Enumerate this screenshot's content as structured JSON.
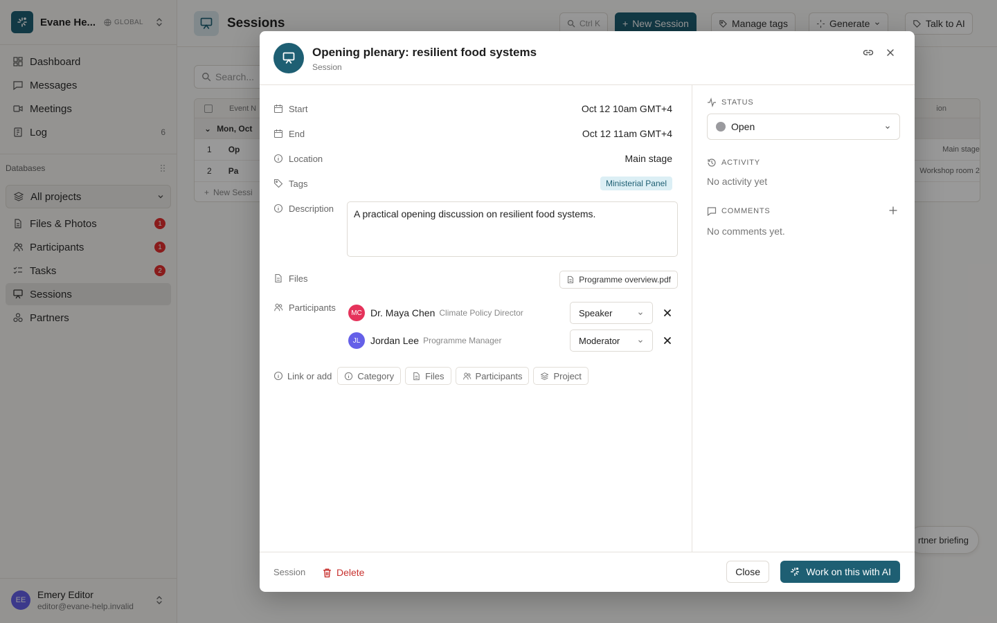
{
  "workspace": {
    "name": "Evane He...",
    "scope": "GLOBAL"
  },
  "sidebar": {
    "nav": [
      {
        "label": "Dashboard"
      },
      {
        "label": "Messages"
      },
      {
        "label": "Meetings"
      },
      {
        "label": "Log",
        "count": "6"
      }
    ],
    "databases_label": "Databases",
    "project_select": "All projects",
    "db_items": [
      {
        "label": "Files & Photos",
        "badge": "1"
      },
      {
        "label": "Participants",
        "badge": "1"
      },
      {
        "label": "Tasks",
        "badge": "2"
      },
      {
        "label": "Sessions"
      },
      {
        "label": "Partners"
      }
    ],
    "user": {
      "initials": "EE",
      "name": "Emery Editor",
      "email": "editor@evane-help.invalid"
    }
  },
  "page": {
    "title": "Sessions",
    "toolbar": {
      "search_shortcut": "Ctrl K",
      "new_session": "New Session",
      "manage_tags": "Manage tags",
      "generate": "Generate",
      "talk_to_ai": "Talk to AI"
    },
    "search_placeholder": "Search...",
    "table": {
      "col_event": "Event N",
      "col_last": "ion",
      "group": "Mon, Oct",
      "rows": [
        {
          "num": "1",
          "name": "Op",
          "location": "Main stage"
        },
        {
          "num": "2",
          "name": "Pa",
          "location": "Workshop room 2"
        }
      ],
      "new_row": "New Sessi"
    },
    "floating": "rtner briefing"
  },
  "modal": {
    "title": "Opening plenary: resilient food systems",
    "subtitle": "Session",
    "props": {
      "start_label": "Start",
      "start_value": "Oct 12 10am GMT+4",
      "end_label": "End",
      "end_value": "Oct 12 11am GMT+4",
      "location_label": "Location",
      "location_value": "Main stage",
      "tags_label": "Tags",
      "tag": "Ministerial Panel",
      "description_label": "Description",
      "description": "A practical opening discussion on resilient food systems.",
      "files_label": "Files",
      "file": "Programme overview.pdf",
      "participants_label": "Participants"
    },
    "participants": [
      {
        "initials": "MC",
        "name": "Dr. Maya Chen",
        "role": "Climate Policy Director",
        "assignment": "Speaker",
        "color": "#e5335b"
      },
      {
        "initials": "JL",
        "name": "Jordan Lee",
        "role": "Programme Manager",
        "assignment": "Moderator",
        "color": "#6560e8"
      }
    ],
    "link_or_add": {
      "label": "Link or add",
      "chips": [
        "Category",
        "Files",
        "Participants",
        "Project"
      ]
    },
    "right": {
      "status_label": "STATUS",
      "status_value": "Open",
      "activity_label": "ACTIVITY",
      "activity_value": "No activity yet",
      "comments_label": "COMMENTS",
      "comments_value": "No comments yet."
    },
    "footer": {
      "label": "Session",
      "delete": "Delete",
      "close": "Close",
      "ai": "Work on this with AI"
    }
  },
  "colors": {
    "brand": "#1e5f73",
    "danger": "#c8322f",
    "badge": "#e5302f",
    "tag_bg": "#dceff5"
  }
}
